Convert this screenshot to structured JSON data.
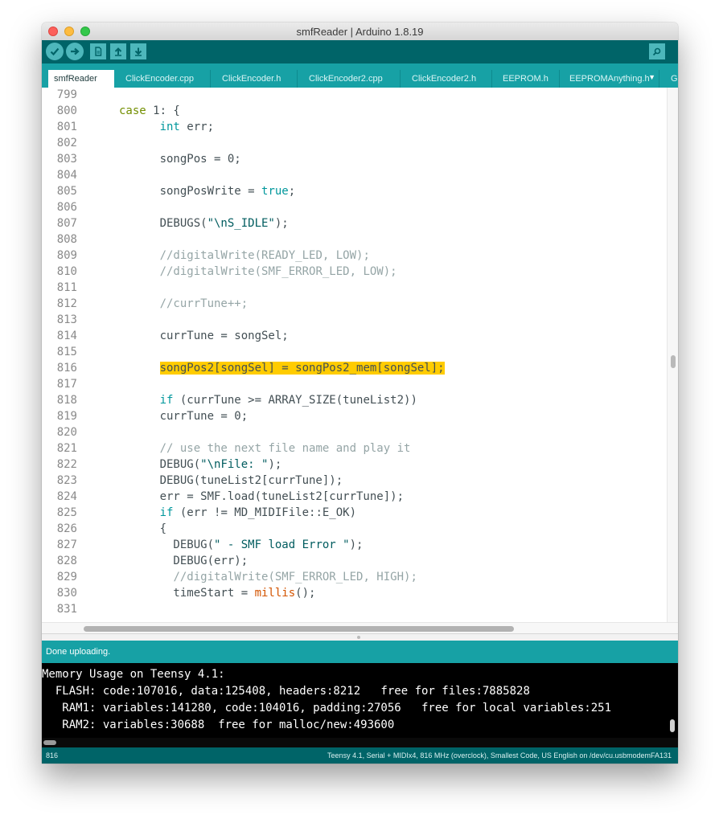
{
  "window": {
    "title": "smfReader | Arduino 1.8.19"
  },
  "toolbar": {
    "buttons": [
      "verify-icon",
      "upload-icon",
      "new-icon",
      "open-icon",
      "save-icon"
    ],
    "serial_monitor_icon": "magnifier-icon"
  },
  "tabs": [
    {
      "label": "smfReader",
      "active": true
    },
    {
      "label": "ClickEncoder.cpp"
    },
    {
      "label": "ClickEncoder.h"
    },
    {
      "label": "ClickEncoder2.cpp"
    },
    {
      "label": "ClickEncoder2.h"
    },
    {
      "label": "EEPROM.h"
    },
    {
      "label": "EEPROMAnything.h"
    },
    {
      "label": "G"
    }
  ],
  "editor": {
    "lines": [
      {
        "n": "799",
        "text": ""
      },
      {
        "n": "800",
        "text": "case 1: {"
      },
      {
        "n": "801",
        "text": "      int err;"
      },
      {
        "n": "802",
        "text": ""
      },
      {
        "n": "803",
        "text": "      songPos = 0;"
      },
      {
        "n": "804",
        "text": ""
      },
      {
        "n": "805",
        "text": "      songPosWrite = true;"
      },
      {
        "n": "806",
        "text": ""
      },
      {
        "n": "807",
        "text": "      DEBUGS(\"\\nS_IDLE\");"
      },
      {
        "n": "808",
        "text": ""
      },
      {
        "n": "809",
        "text": "      //digitalWrite(READY_LED, LOW);"
      },
      {
        "n": "810",
        "text": "      //digitalWrite(SMF_ERROR_LED, LOW);"
      },
      {
        "n": "811",
        "text": ""
      },
      {
        "n": "812",
        "text": "      //currTune++;"
      },
      {
        "n": "813",
        "text": ""
      },
      {
        "n": "814",
        "text": "      currTune = songSel;"
      },
      {
        "n": "815",
        "text": ""
      },
      {
        "n": "816",
        "text": "      songPos2[songSel] = songPos2_mem[songSel];",
        "highlight": true
      },
      {
        "n": "817",
        "text": ""
      },
      {
        "n": "818",
        "text": "      if (currTune >= ARRAY_SIZE(tuneList2))"
      },
      {
        "n": "819",
        "text": "      currTune = 0;"
      },
      {
        "n": "820",
        "text": ""
      },
      {
        "n": "821",
        "text": "      // use the next file name and play it"
      },
      {
        "n": "822",
        "text": "      DEBUG(\"\\nFile: \");"
      },
      {
        "n": "823",
        "text": "      DEBUG(tuneList2[currTune]);"
      },
      {
        "n": "824",
        "text": "      err = SMF.load(tuneList2[currTune]);"
      },
      {
        "n": "825",
        "text": "      if (err != MD_MIDIFile::E_OK)"
      },
      {
        "n": "826",
        "text": "      {"
      },
      {
        "n": "827",
        "text": "        DEBUG(\" - SMF load Error \");"
      },
      {
        "n": "828",
        "text": "        DEBUG(err);"
      },
      {
        "n": "829",
        "text": "        //digitalWrite(SMF_ERROR_LED, HIGH);"
      },
      {
        "n": "830",
        "text": "        timeStart = millis();"
      },
      {
        "n": "831",
        "text": ""
      }
    ]
  },
  "status": {
    "message": "Done uploading."
  },
  "console": {
    "lines": [
      "Memory Usage on Teensy 4.1:",
      "  FLASH: code:107016, data:125408, headers:8212   free for files:7885828",
      "   RAM1: variables:141280, code:104016, padding:27056   free for local variables:251",
      "   RAM2: variables:30688  free for malloc/new:493600"
    ]
  },
  "footer": {
    "line_number": "816",
    "board_info": "Teensy 4.1, Serial + MIDIx4, 816 MHz (overclock), Smallest Code, US English on /dev/cu.usbmodemFA131"
  }
}
